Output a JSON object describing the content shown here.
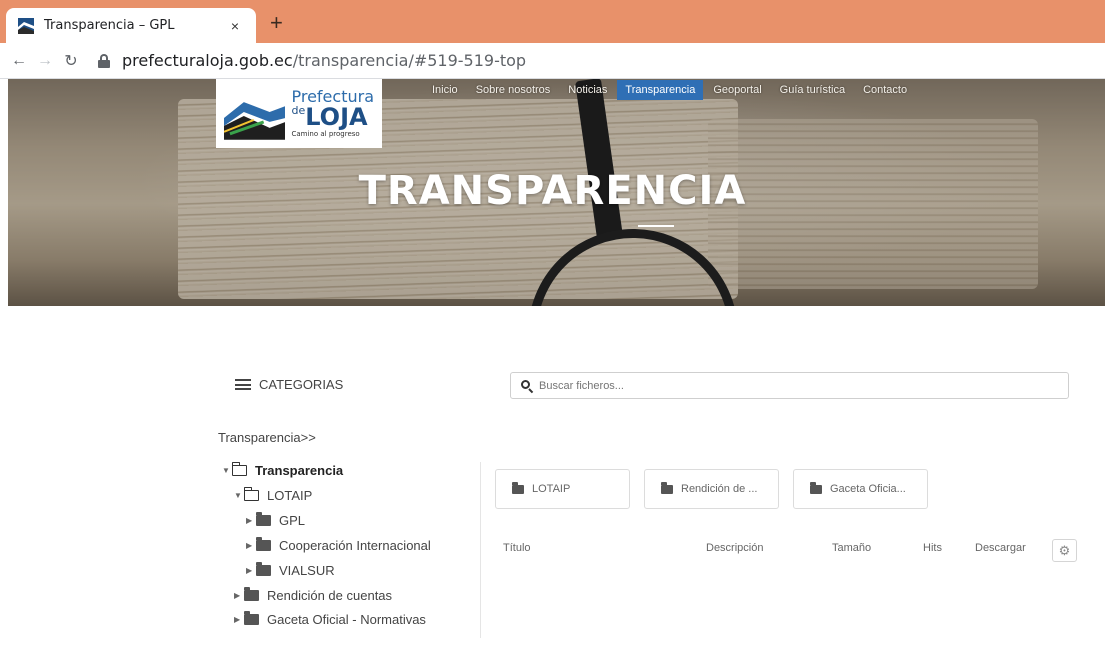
{
  "browser": {
    "tab_title": "Transparencia – GPL",
    "tab_close": "×",
    "new_tab": "+",
    "url_domain": "prefecturaloja.gob.ec",
    "url_path": "/transparencia/#519-519-top",
    "accent_color": "#e8916a"
  },
  "site": {
    "logo": {
      "line1": "Prefectura",
      "line2_prefix": "de",
      "line2": "LOJA",
      "tagline": "Camino al progreso"
    },
    "nav": [
      {
        "label": "Inicio"
      },
      {
        "label": "Sobre nosotros"
      },
      {
        "label": "Noticias"
      },
      {
        "label": "Transparencia",
        "active": true
      },
      {
        "label": "Geoportal"
      },
      {
        "label": "Guía turística"
      },
      {
        "label": "Contacto"
      }
    ],
    "hero_title": "TRANSPARENCIA",
    "active_color": "#2f6fb5"
  },
  "files": {
    "categories_label": "CATEGORIAS",
    "search_placeholder": "Buscar ficheros...",
    "breadcrumb": "Transparencia>>",
    "tree": [
      {
        "label": "Transparencia",
        "level": 0,
        "expanded": true
      },
      {
        "label": "LOTAIP",
        "level": 1,
        "expanded": true
      },
      {
        "label": "GPL",
        "level": 2
      },
      {
        "label": "Cooperación Internacional",
        "level": 2
      },
      {
        "label": "VIALSUR",
        "level": 2
      },
      {
        "label": "Rendición de cuentas",
        "level": 1
      },
      {
        "label": "Gaceta Oficial - Normativas",
        "level": 1
      }
    ],
    "folders": [
      {
        "label": "LOTAIP"
      },
      {
        "label": "Rendición de ..."
      },
      {
        "label": "Gaceta Oficia..."
      }
    ],
    "columns": [
      "Título",
      "Descripción",
      "Tamaño",
      "Hits",
      "Descargar"
    ]
  }
}
